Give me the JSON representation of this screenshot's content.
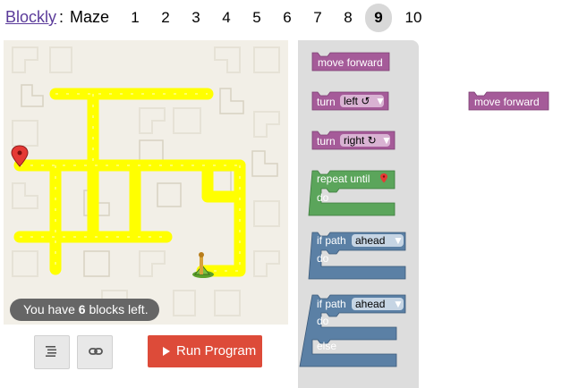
{
  "header": {
    "title_link": "Blockly",
    "separator": ":",
    "title": "Maze",
    "levels": [
      "1",
      "2",
      "3",
      "4",
      "5",
      "6",
      "7",
      "8",
      "9",
      "10"
    ],
    "current_level": "9"
  },
  "game": {
    "blocks_left_prefix": "You have",
    "blocks_left_count": "6",
    "blocks_left_suffix": "blocks left."
  },
  "toolbar": {
    "code_icon": "code-lines-icon",
    "link_icon": "link-icon",
    "run_label": "Run Program",
    "run_icon": "play-icon",
    "run_color": "#dd4b39"
  },
  "toolbox": {
    "move_forward": "move forward",
    "turn_label": "turn",
    "turn_left": "left ↺",
    "turn_right": "right ↻",
    "repeat_until": "repeat until",
    "do": "do",
    "if_path": "if path",
    "ahead": "ahead",
    "else": "else"
  },
  "workspace": {
    "move_forward": "move forward"
  },
  "colors": {
    "movement_block": "#a55b99",
    "loop_block": "#5ba55b",
    "logic_block": "#5b80a5",
    "path": "#ffff00",
    "maze_bg": "#f2efe7"
  }
}
